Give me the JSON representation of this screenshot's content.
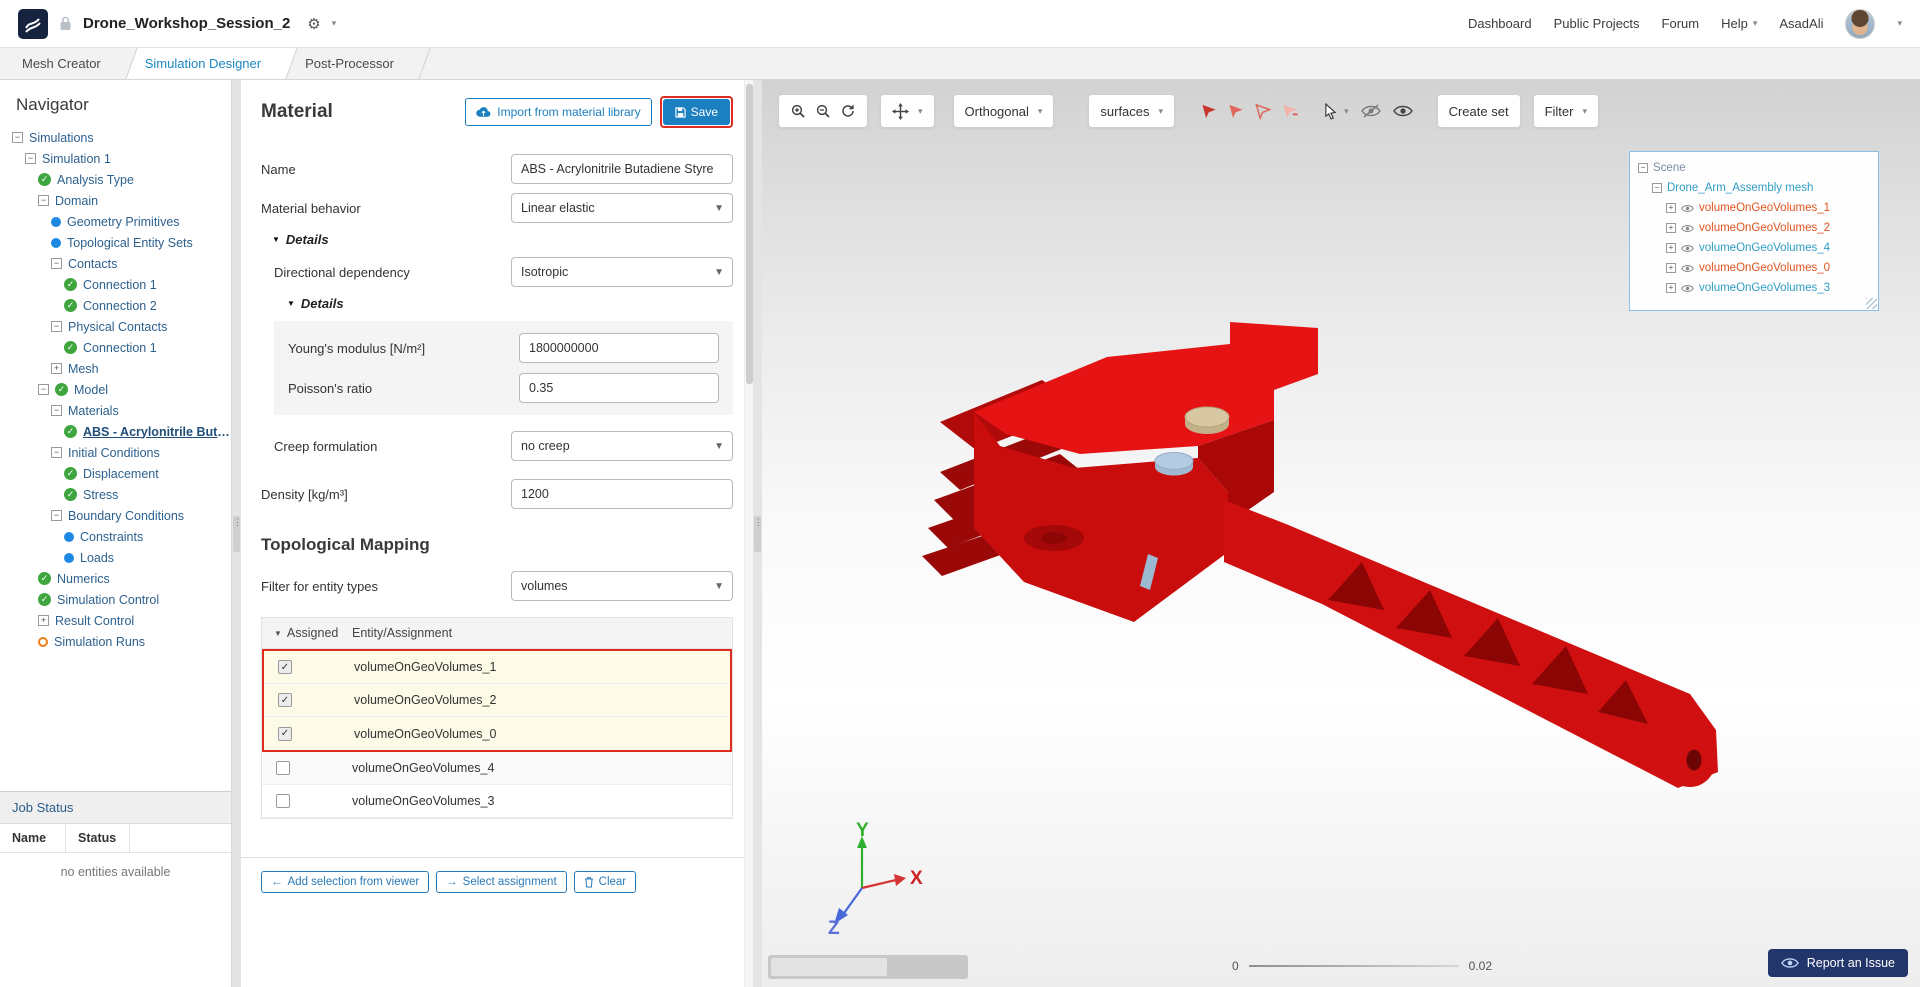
{
  "header": {
    "project_title": "Drone_Workshop_Session_2",
    "nav_links": [
      "Dashboard",
      "Public Projects",
      "Forum"
    ],
    "help_label": "Help",
    "user_name": "AsadAli"
  },
  "tabs": [
    {
      "label": "Mesh Creator",
      "active": false
    },
    {
      "label": "Simulation Designer",
      "active": true
    },
    {
      "label": "Post-Processor",
      "active": false
    }
  ],
  "navigator": {
    "title": "Navigator",
    "tree": [
      {
        "label": "Simulations",
        "depth": 0,
        "exp": "minus"
      },
      {
        "label": "Simulation 1",
        "depth": 1,
        "exp": "minus"
      },
      {
        "label": "Analysis Type",
        "depth": 2,
        "status": "check"
      },
      {
        "label": "Domain",
        "depth": 2,
        "exp": "minus"
      },
      {
        "label": "Geometry Primitives",
        "depth": 3,
        "status": "dot"
      },
      {
        "label": "Topological Entity Sets",
        "depth": 3,
        "status": "dot"
      },
      {
        "label": "Contacts",
        "depth": 3,
        "exp": "minus"
      },
      {
        "label": "Connection 1",
        "depth": 4,
        "status": "check"
      },
      {
        "label": "Connection 2",
        "depth": 4,
        "status": "check"
      },
      {
        "label": "Physical Contacts",
        "depth": 3,
        "exp": "minus"
      },
      {
        "label": "Connection 1",
        "depth": 4,
        "status": "check"
      },
      {
        "label": "Mesh",
        "depth": 3,
        "exp": "plus"
      },
      {
        "label": "Model",
        "depth": 2,
        "exp": "minus",
        "status": "check"
      },
      {
        "label": "Materials",
        "depth": 3,
        "exp": "minus"
      },
      {
        "label": "ABS - Acrylonitrile Buta...",
        "depth": 4,
        "status": "check",
        "selected": true
      },
      {
        "label": "Initial Conditions",
        "depth": 3,
        "exp": "minus"
      },
      {
        "label": "Displacement",
        "depth": 4,
        "status": "check"
      },
      {
        "label": "Stress",
        "depth": 4,
        "status": "check"
      },
      {
        "label": "Boundary Conditions",
        "depth": 3,
        "exp": "minus"
      },
      {
        "label": "Constraints",
        "depth": 4,
        "status": "dot"
      },
      {
        "label": "Loads",
        "depth": 4,
        "status": "dot"
      },
      {
        "label": "Numerics",
        "depth": 2,
        "status": "check"
      },
      {
        "label": "Simulation Control",
        "depth": 2,
        "status": "check"
      },
      {
        "label": "Result Control",
        "depth": 2,
        "exp": "plus"
      },
      {
        "label": "Simulation Runs",
        "depth": 2,
        "status": "ring"
      }
    ],
    "job_status": {
      "title": "Job Status",
      "columns": [
        "Name",
        "Status"
      ],
      "empty_message": "no entities available"
    }
  },
  "material_panel": {
    "title": "Material",
    "import_button_label": "Import from material library",
    "save_button_label": "Save",
    "name_label": "Name",
    "name_value": "ABS - Acrylonitrile Butadiene Styre",
    "behavior_label": "Material behavior",
    "behavior_value": "Linear elastic",
    "details_label": "Details",
    "directional_label": "Directional dependency",
    "directional_value": "Isotropic",
    "inner_details_label": "Details",
    "youngs_label": "Young's modulus [N/m²]",
    "youngs_value": "1800000000",
    "poisson_label": "Poisson's ratio",
    "poisson_value": "0.35",
    "creep_label": "Creep formulation",
    "creep_value": "no creep",
    "density_label": "Density [kg/m³]",
    "density_value": "1200",
    "topological_mapping": {
      "title": "Topological Mapping",
      "filter_label": "Filter for entity types",
      "filter_value": "volumes",
      "columns": [
        "Assigned",
        "Entity/Assignment"
      ],
      "rows": [
        {
          "name": "volumeOnGeoVolumes_1",
          "checked": true
        },
        {
          "name": "volumeOnGeoVolumes_2",
          "checked": true
        },
        {
          "name": "volumeOnGeoVolumes_0",
          "checked": true
        },
        {
          "name": "volumeOnGeoVolumes_4",
          "checked": false
        },
        {
          "name": "volumeOnGeoVolumes_3",
          "checked": false
        }
      ],
      "action_buttons": [
        "Add selection from viewer",
        "Select assignment",
        "Clear"
      ]
    }
  },
  "viewer": {
    "toolbar": {
      "projection_value": "Orthogonal",
      "render_mode_value": "surfaces",
      "create_set_label": "Create set",
      "filter_label": "Filter",
      "icons": [
        "zoom-in",
        "zoom-out",
        "reset-view",
        "pan",
        "pick-volume",
        "pick-face",
        "pick-edge",
        "pick-vertex",
        "cursor",
        "hide-entities",
        "show-entities"
      ]
    },
    "scene_tree": {
      "root_label": "Scene",
      "mesh_label": "Drone_Arm_Assembly mesh",
      "items": [
        {
          "label": "volumeOnGeoVolumes_1",
          "assigned": true
        },
        {
          "label": "volumeOnGeoVolumes_2",
          "assigned": true
        },
        {
          "label": "volumeOnGeoVolumes_4",
          "assigned": false
        },
        {
          "label": "volumeOnGeoVolumes_0",
          "assigned": true
        },
        {
          "label": "volumeOnGeoVolumes_3",
          "assigned": false
        }
      ],
      "root_color": "#7c8ea3",
      "mesh_color": "#2f9dc4",
      "assigned_color": "#e0531f",
      "unassigned_color": "#2f9dc4"
    },
    "axes": {
      "x": "X",
      "y": "Y",
      "z": "Z"
    },
    "axis_colors": {
      "x": "#cc2222",
      "y": "#2eaf2e",
      "z": "#5b6fd6"
    },
    "scale_bar": {
      "min": "0",
      "max": "0.02"
    },
    "report_button_label": "Report an Issue",
    "model_color": "#d01010"
  },
  "annotations": {
    "color": "#e02b20",
    "highlighted_elements": [
      "save-button",
      "assigned-entity-rows"
    ]
  }
}
